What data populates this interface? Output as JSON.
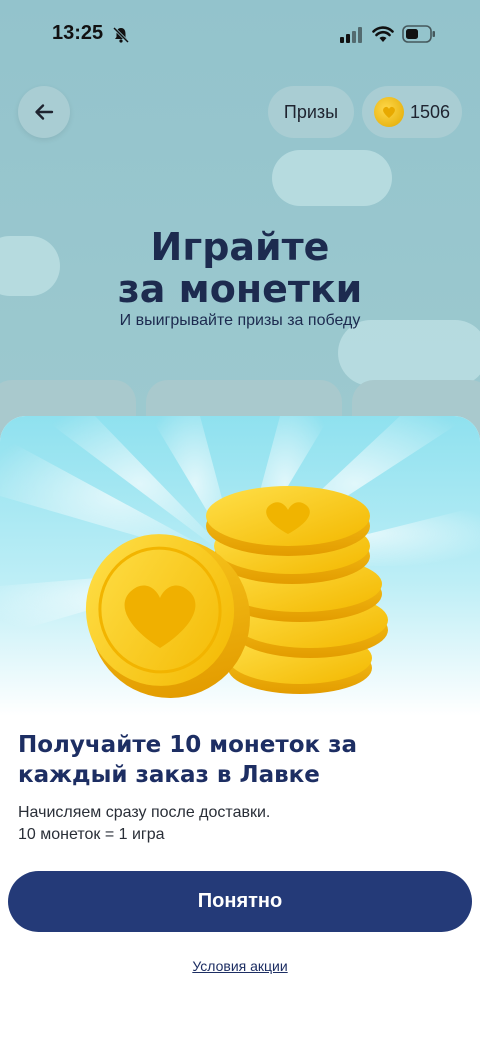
{
  "status_bar": {
    "time": "13:25"
  },
  "header": {
    "prizes_label": "Призы",
    "coins_count": "1506"
  },
  "hero": {
    "title_line1": "Играйте",
    "title_line2": "за монетки",
    "subtitle": "И выигрывайте призы за победу"
  },
  "sheet": {
    "title": "Получайте 10 монеток за каждый заказ в Лавке",
    "desc_line1": "Начисляем сразу после доставки.",
    "desc_line2": "10 монеток = 1 игра",
    "ok_label": "Понятно",
    "terms_label": "Условия акции"
  },
  "colors": {
    "primary_button": "#243a78",
    "title_text": "#1d2e63",
    "coin_gold": "#f5c21a",
    "sky": "#8fe1ef"
  },
  "icons": {
    "back": "arrow-left-icon",
    "coin": "coin-heart-icon",
    "bell": "bell-slash-icon",
    "signal": "signal-icon",
    "wifi": "wifi-icon",
    "battery": "battery-icon"
  }
}
